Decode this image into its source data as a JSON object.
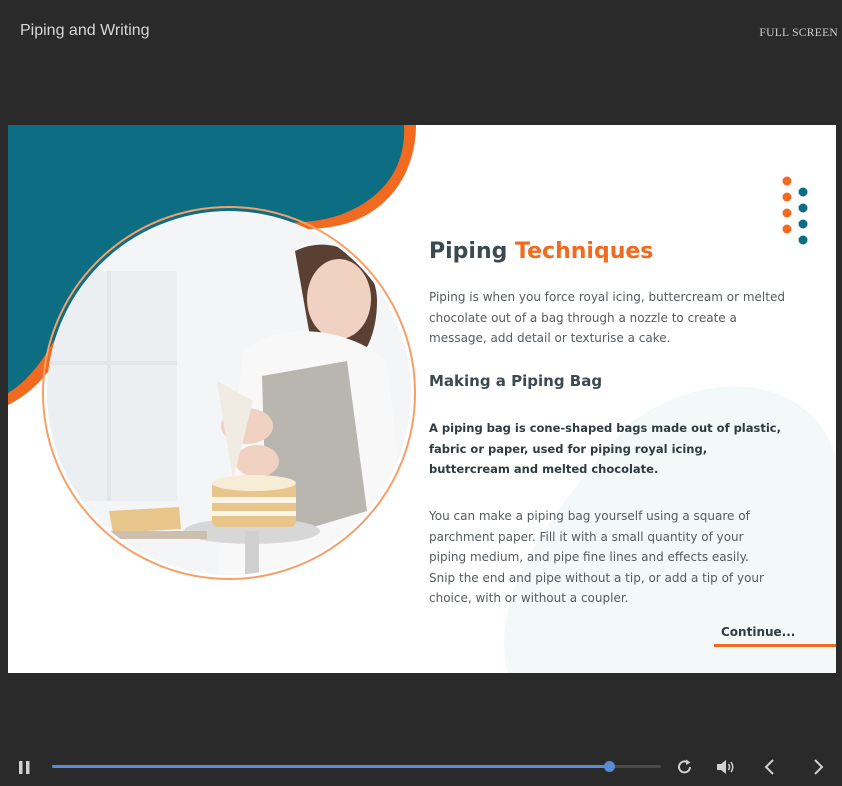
{
  "header": {
    "title": "Piping and Writing",
    "fullscreen_label": "FULL SCREEN"
  },
  "slide": {
    "title_main": "Piping",
    "title_accent": "Techniques",
    "intro": "Piping is when you force royal icing, buttercream or melted chocolate out of a bag through a nozzle to create a message, add detail or texturise a cake.",
    "subheading": "Making a Piping Bag",
    "definition": "A piping bag is cone-shaped bags made out of plastic, fabric or paper, used for piping royal icing, buttercream and melted chocolate.",
    "instructions": "You can make a piping bag yourself using a square of parchment paper. Fill it with a small quantity of your piping medium, and pipe fine lines and effects easily. Snip the end and pipe without a tip, or add a tip of your choice, with or without a coupler.",
    "continue_label": "Continue...",
    "colors": {
      "accent": "#f26a1f",
      "teal": "#0d6e83",
      "heading": "#3b4a51"
    }
  },
  "player": {
    "progress": 0.915,
    "icons": {
      "play_pause": "pause-icon",
      "replay": "replay-icon",
      "volume": "volume-icon",
      "previous": "chevron-left-icon",
      "next": "chevron-right-icon"
    },
    "accent_color": "#5b8bd6"
  }
}
